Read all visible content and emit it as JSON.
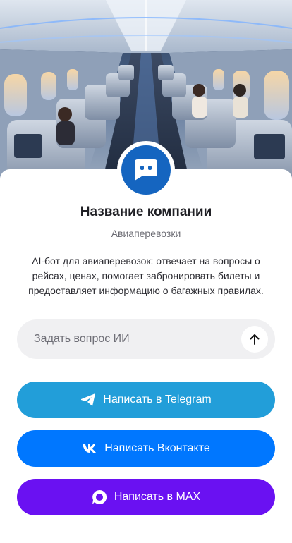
{
  "company": {
    "name": "Название компании",
    "category": "Авиаперевозки",
    "description": "AI-бот для авиаперевозок: отвечает на вопросы о рейсах, ценах, помогает забронировать билеты и предоставляет информацию о багажных правилах."
  },
  "ask": {
    "placeholder": "Задать вопрос ИИ"
  },
  "buttons": {
    "telegram": {
      "label": "Написать в Telegram",
      "icon": "telegram-icon",
      "color": "#229ed9"
    },
    "vk": {
      "label": "Написать Вконтакте",
      "icon": "vk-icon",
      "color": "#0077ff"
    },
    "max": {
      "label": "Написать в MAX",
      "icon": "max-icon",
      "color": "#6a11f2"
    }
  },
  "colors": {
    "avatar": "#1565c0",
    "input_bg": "#f0f0f2"
  },
  "icons": {
    "avatar": "chat-bot-icon",
    "send": "arrow-up-icon"
  }
}
